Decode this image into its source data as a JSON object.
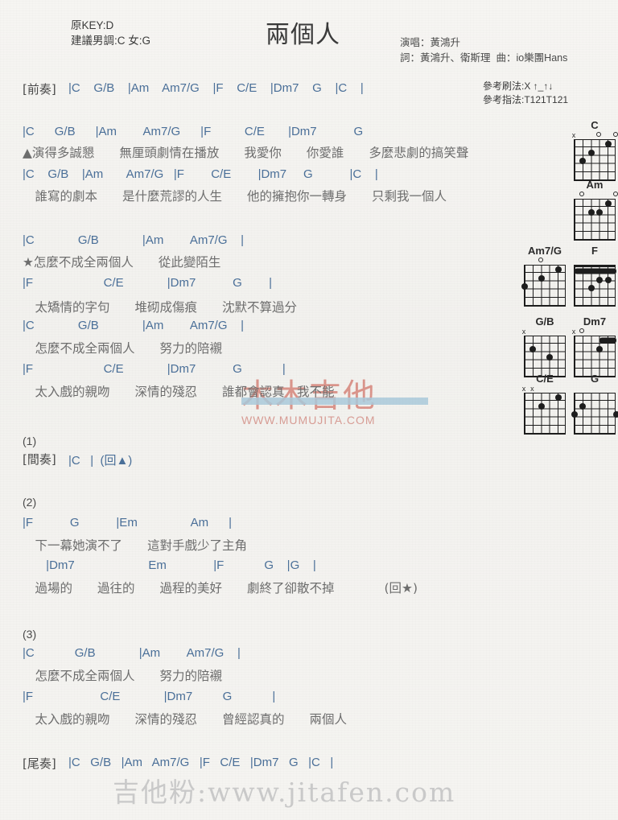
{
  "header": {
    "key_info": "原KEY:D\n建議男調:C 女:G",
    "title": "兩個人",
    "credits": "演唱：黃鴻升\n詞：黃鴻升、衛斯理  曲：io樂團Hans",
    "strum_info": "參考刷法:X ↑_↑↓\n參考指法:T121T121"
  },
  "sections": {
    "intro_label": "[前奏]",
    "intro_chords": "|C    G/B    |Am    Am7/G    |F    C/E    |Dm7    G    |C    |",
    "interlude_label": "[間奏]",
    "interlude_chords": "|C   |  (回▲)",
    "outro_label": "[尾奏]",
    "outro_chords": "|C   G/B   |Am   Am7/G   |F   C/E   |Dm7   G   |C   |",
    "num1": "(1)",
    "num2": "(2)",
    "num3": "(3)"
  },
  "lines": {
    "v1a_chords": "|C      G/B      |Am        Am7/G      |F          C/E       |Dm7           G",
    "v1a_lyric": "▲演得多誠懇　　無厘頭劇情在播放　　我愛你　　你愛誰　　多麼悲劇的搞笑聲",
    "v1b_chords": "|C    G/B    |Am       Am7/G   |F        C/E        |Dm7     G           |C    |",
    "v1b_lyric": "　誰寫的劇本　　是什麼荒謬的人生　　他的擁抱你一轉身　　只剩我一個人",
    "c1_chords": "|C             G/B             |Am        Am7/G    |",
    "c1_lyric": "★怎麼不成全兩個人　　從此變陌生",
    "c2_chords": "|F                     C/E             |Dm7           G        |",
    "c2_lyric": "　太矯情的字句　　堆砌成傷痕　　沈默不算過分",
    "c3_chords": "|C             G/B             |Am        Am7/G    |",
    "c3_lyric": "　怎麼不成全兩個人　　努力的陪襯",
    "c4_chords": "|F                     C/E             |Dm7           G            |",
    "c4_lyric": "　太入戲的親吻　　深情的殘忍　　誰都會認真　我不能",
    "b1_chords": "|F           G           |Em                Am      |",
    "b1_lyric": "　下一幕她演不了　　這對手戲少了主角",
    "b2_chords": "       |Dm7                      Em              |F            G    |G    |",
    "b2_lyric": "　過場的　　過往的　　過程的美好　　劇終了卻散不掉　　　　(回★)",
    "e1_chords": "|C            G/B             |Am        Am7/G    |",
    "e1_lyric": "　怎麼不成全兩個人　　努力的陪襯",
    "e2_chords": "|F                    C/E             |Dm7         G            |",
    "e2_lyric": "　太入戲的親吻　　深情的殘忍　　曾經認真的　　兩個人"
  },
  "chord_diagrams": [
    {
      "name": "C",
      "markers": [
        {
          "type": "x",
          "string": 6
        },
        {
          "type": "o",
          "string": 3
        },
        {
          "type": "o",
          "string": 1
        }
      ],
      "nut": false,
      "dots": [
        {
          "string": 5,
          "fret": 3
        },
        {
          "string": 4,
          "fret": 2
        },
        {
          "string": 2,
          "fret": 1
        }
      ],
      "barre": null
    },
    {
      "name": "Am",
      "markers": [
        {
          "type": "o",
          "string": 5
        },
        {
          "type": "o",
          "string": 1
        }
      ],
      "nut": false,
      "dots": [
        {
          "string": 4,
          "fret": 2
        },
        {
          "string": 3,
          "fret": 2
        },
        {
          "string": 2,
          "fret": 1
        }
      ],
      "barre": null
    },
    {
      "name": "Am7/G",
      "markers": [
        {
          "type": "o",
          "string": 4
        }
      ],
      "nut": false,
      "dots": [
        {
          "string": 6,
          "fret": 3
        },
        {
          "string": 4,
          "fret": 2
        },
        {
          "string": 2,
          "fret": 1
        }
      ],
      "barre": null
    },
    {
      "name": "F",
      "markers": [],
      "nut": true,
      "dots": [
        {
          "string": 4,
          "fret": 3
        },
        {
          "string": 3,
          "fret": 2
        },
        {
          "string": 2,
          "fret": 2
        }
      ],
      "barre": {
        "fret": 1,
        "from_string": 6,
        "to_string": 1
      }
    },
    {
      "name": "G/B",
      "markers": [
        {
          "type": "x",
          "string": 6
        }
      ],
      "nut": false,
      "dots": [
        {
          "string": 5,
          "fret": 2
        },
        {
          "string": 3,
          "fret": 3
        }
      ],
      "barre": null
    },
    {
      "name": "Dm7",
      "markers": [
        {
          "type": "x",
          "string": 6
        },
        {
          "type": "o",
          "string": 5
        }
      ],
      "nut": false,
      "dots": [
        {
          "string": 3,
          "fret": 2
        }
      ],
      "barre": {
        "fret": 1,
        "from_string": 3,
        "to_string": 1
      }
    },
    {
      "name": "C/E",
      "markers": [
        {
          "type": "x",
          "string": 6
        },
        {
          "type": "x",
          "string": 5
        }
      ],
      "nut": false,
      "dots": [
        {
          "string": 4,
          "fret": 2
        },
        {
          "string": 2,
          "fret": 1
        }
      ],
      "barre": null
    },
    {
      "name": "G",
      "markers": [],
      "nut": false,
      "dots": [
        {
          "string": 6,
          "fret": 3
        },
        {
          "string": 5,
          "fret": 2
        },
        {
          "string": 1,
          "fret": 3
        }
      ],
      "barre": null
    }
  ],
  "watermarks": {
    "mumu_cn": "木木吉他",
    "mumu_url": "WWW.MUMUJITA.COM",
    "bottom": "吉他粉:www.jitafen.com"
  },
  "colors": {
    "chord_blue": "#4a6f98",
    "lyric_gray": "#6d6d6d",
    "watermark_red": "#c74a3c",
    "watermark_blue": "#6fa8c9"
  }
}
